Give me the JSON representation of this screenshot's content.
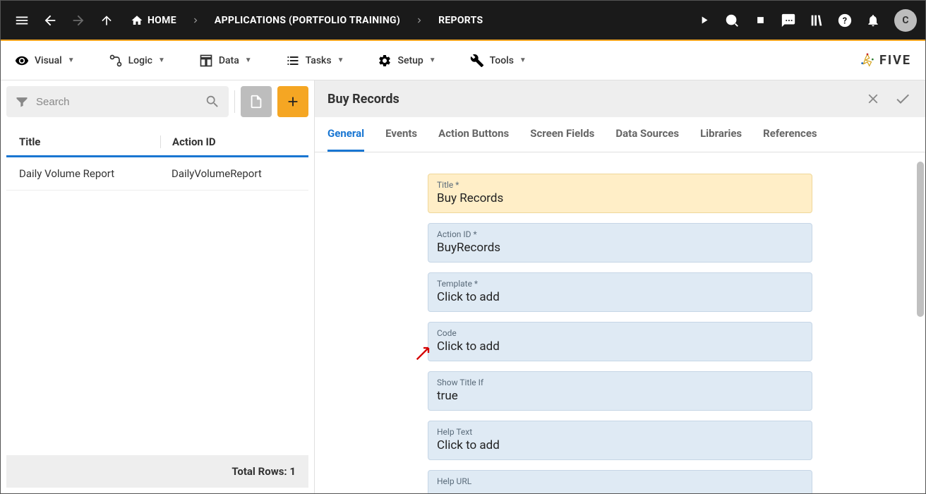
{
  "topbar": {
    "breadcrumb": {
      "home": "HOME",
      "app": "APPLICATIONS (PORTFOLIO TRAINING)",
      "page": "REPORTS"
    },
    "user_initial": "C"
  },
  "menubar": {
    "visual": "Visual",
    "logic": "Logic",
    "data": "Data",
    "tasks": "Tasks",
    "setup": "Setup",
    "tools": "Tools",
    "brand": "FIVE"
  },
  "left": {
    "search_placeholder": "Search",
    "columns": {
      "title": "Title",
      "action_id": "Action ID"
    },
    "rows": [
      {
        "title": "Daily Volume Report",
        "action_id": "DailyVolumeReport"
      }
    ],
    "total_label": "Total Rows:",
    "total_value": "1"
  },
  "right": {
    "header_title": "Buy Records",
    "tabs": {
      "general": "General",
      "events": "Events",
      "action_buttons": "Action Buttons",
      "screen_fields": "Screen Fields",
      "data_sources": "Data Sources",
      "libraries": "Libraries",
      "references": "References"
    },
    "fields": {
      "title": {
        "label": "Title *",
        "value": "Buy Records"
      },
      "action_id": {
        "label": "Action ID *",
        "value": "BuyRecords"
      },
      "template": {
        "label": "Template *",
        "value": "Click to add"
      },
      "code": {
        "label": "Code",
        "value": "Click to add"
      },
      "show_title_if": {
        "label": "Show Title If",
        "value": "true"
      },
      "help_text": {
        "label": "Help Text",
        "value": "Click to add"
      },
      "help_url": {
        "label": "Help URL",
        "value": ""
      }
    }
  }
}
